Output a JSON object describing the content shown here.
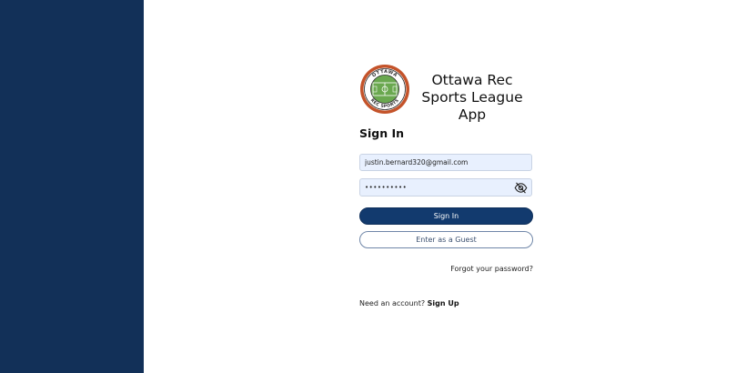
{
  "app": {
    "title": "Ottawa Rec Sports League App",
    "logo_text_top": "OTTAWA",
    "logo_text_bottom": "REC SPORTS"
  },
  "signin": {
    "heading": "Sign In",
    "email_value": "justin.bernard320@gmail.com",
    "password_value": "••••••••••",
    "signin_button": "Sign In",
    "guest_button": "Enter as a Guest",
    "forgot_link": "Forgot your password?",
    "need_account_text": "Need an account?",
    "signup_link": "Sign Up"
  },
  "colors": {
    "sidebar": "#123058",
    "primary_button": "#123a6e",
    "field_bg": "#e8f0fe",
    "logo_ring": "#c4532a",
    "logo_field": "#6aa84f"
  }
}
